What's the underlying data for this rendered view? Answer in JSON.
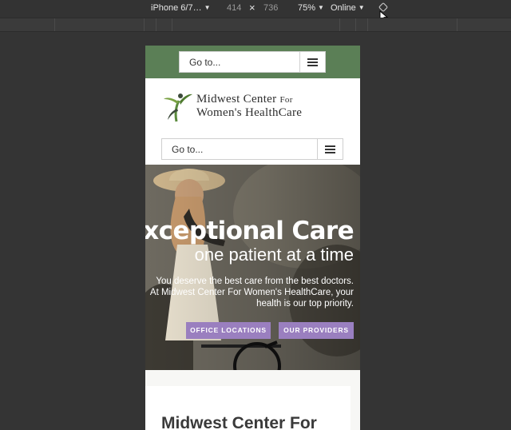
{
  "devtools": {
    "device": "iPhone 6/7…",
    "width": "414",
    "times": "×",
    "height": "736",
    "zoom": "75%",
    "network": "Online",
    "caret": "▼"
  },
  "site": {
    "nav_top": {
      "label": "Go to..."
    },
    "logo": {
      "line1_main": "Midwest Center ",
      "line1_small": "For",
      "line2": "Women's HealthCare"
    },
    "nav_main": {
      "label": "Go to..."
    },
    "hero": {
      "title": "Exceptional Care",
      "subtitle": "one patient at a time",
      "description": "You deserve the best care from the best doctors. At Midwest Center For Women's HealthCare, your health is our top priority.",
      "button_locations": "OFFICE LOCATIONS",
      "button_providers": "OUR PROVIDERS"
    },
    "section_heading": "Midwest Center For"
  },
  "colors": {
    "header_green": "#5b7f56",
    "button_purple": "#9a7fbf",
    "devtools_bg": "#343434"
  }
}
